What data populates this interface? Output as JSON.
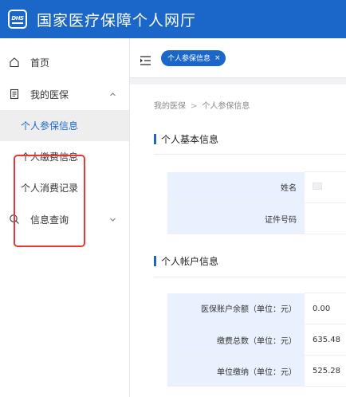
{
  "header": {
    "logo_text": "DHS",
    "title": "国家医疗保障个人网厅"
  },
  "sidebar": {
    "home": {
      "label": "首页"
    },
    "my_insurance": {
      "label": "我的医保",
      "children": [
        {
          "label": "个人参保信息"
        },
        {
          "label": "个人缴费信息"
        },
        {
          "label": "个人消费记录"
        }
      ]
    },
    "info_query": {
      "label": "信息查询"
    }
  },
  "tabs": [
    {
      "label": "个人参保信息",
      "close": "×"
    }
  ],
  "breadcrumb": {
    "parent": "我的医保",
    "separator": ">",
    "current": "个人参保信息"
  },
  "basic_info": {
    "title": "个人基本信息",
    "rows": [
      {
        "label": "姓名",
        "value": ""
      },
      {
        "label": "证件号码",
        "value": ""
      }
    ]
  },
  "account_info": {
    "title": "个人帐户信息",
    "rows": [
      {
        "label": "医保账户余额（单位：元）",
        "value": "0.00"
      },
      {
        "label": "缴费总数（单位：元）",
        "value": "635.48"
      },
      {
        "label": "单位缴纳（单位：元）",
        "value": "525.28"
      }
    ]
  },
  "colors": {
    "brand": "#1b67c9",
    "highlight": "#e53935",
    "label_bg": "#e8f1fd"
  }
}
